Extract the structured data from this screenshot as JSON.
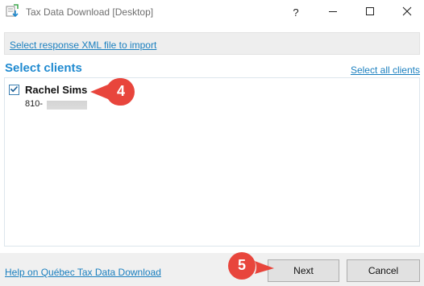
{
  "window": {
    "title": "Tax Data Download [Desktop]",
    "help_glyph": "?",
    "minimize_icon": "minimize-icon",
    "maximize_icon": "maximize-icon",
    "close_icon": "close-icon"
  },
  "import": {
    "link_label": "Select response XML file to import"
  },
  "clients_section": {
    "title": "Select clients",
    "select_all_label": "Select all clients",
    "clients": [
      {
        "name": "Rachel Sims",
        "phone_prefix": "810-",
        "checked": true
      }
    ]
  },
  "callouts": [
    {
      "number": "4",
      "color": "#e8453c"
    },
    {
      "number": "5",
      "color": "#e8453c"
    }
  ],
  "footer": {
    "help_link_label": "Help on Québec Tax Data Download",
    "next_label": "Next",
    "cancel_label": "Cancel"
  },
  "colors": {
    "accent": "#1f8ad0",
    "link": "#1a7fbf",
    "callout": "#e8453c"
  }
}
